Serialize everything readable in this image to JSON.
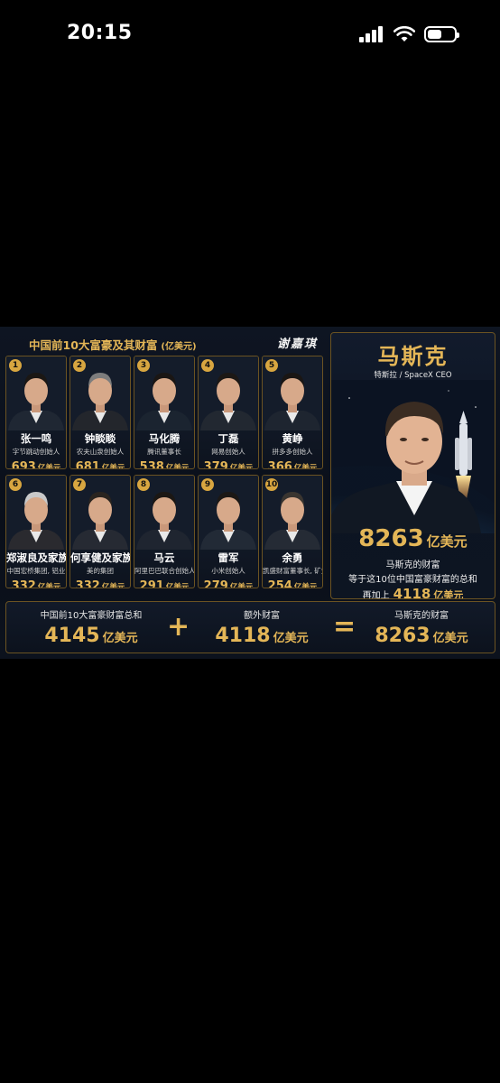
{
  "status_bar": {
    "time": "20:15",
    "battery_level": 0.55
  },
  "infographic": {
    "title": "中国前10大富豪及其财富",
    "title_unit": "(亿美元)",
    "signature": "谢嘉琪",
    "unit": "亿美元",
    "people": [
      {
        "rank": "1",
        "name": "张一鸣",
        "role": "字节跳动创始人",
        "wealth": "693"
      },
      {
        "rank": "2",
        "name": "钟睒睒",
        "role": "农夫山泉创始人",
        "wealth": "681"
      },
      {
        "rank": "3",
        "name": "马化腾",
        "role": "腾讯董事长",
        "wealth": "538"
      },
      {
        "rank": "4",
        "name": "丁磊",
        "role": "网易创始人",
        "wealth": "379"
      },
      {
        "rank": "5",
        "name": "黄峥",
        "role": "拼多多创始人",
        "wealth": "366"
      },
      {
        "rank": "6",
        "name": "郑淑良及家族",
        "role": "中国宏桥集团, 铝业",
        "wealth": "332"
      },
      {
        "rank": "7",
        "name": "何享健及家族",
        "role": "美的集团",
        "wealth": "332"
      },
      {
        "rank": "8",
        "name": "马云",
        "role": "阿里巴巴联合创始人",
        "wealth": "291"
      },
      {
        "rank": "9",
        "name": "雷军",
        "role": "小米创始人",
        "wealth": "279"
      },
      {
        "rank": "10",
        "name": "余勇",
        "role": "凯盛财富董事长, 矿业",
        "wealth": "254"
      }
    ],
    "musk": {
      "name": "马斯克",
      "role": "特斯拉 / SpaceX CEO",
      "wealth": "8263",
      "unit": "亿美元",
      "line1": "马斯克的财富",
      "line2": "等于这10位中国富豪财富的总和",
      "extra_label": "再加上",
      "extra_value": "4118",
      "extra_unit": "亿美元"
    },
    "equation": {
      "left_label": "中国前10大富豪财富总和",
      "left_value": "4145",
      "plus": "+",
      "mid_label": "额外财富",
      "mid_value": "4118",
      "equals": "=",
      "right_label": "马斯克的财富",
      "right_value": "8263",
      "unit": "亿美元"
    }
  }
}
